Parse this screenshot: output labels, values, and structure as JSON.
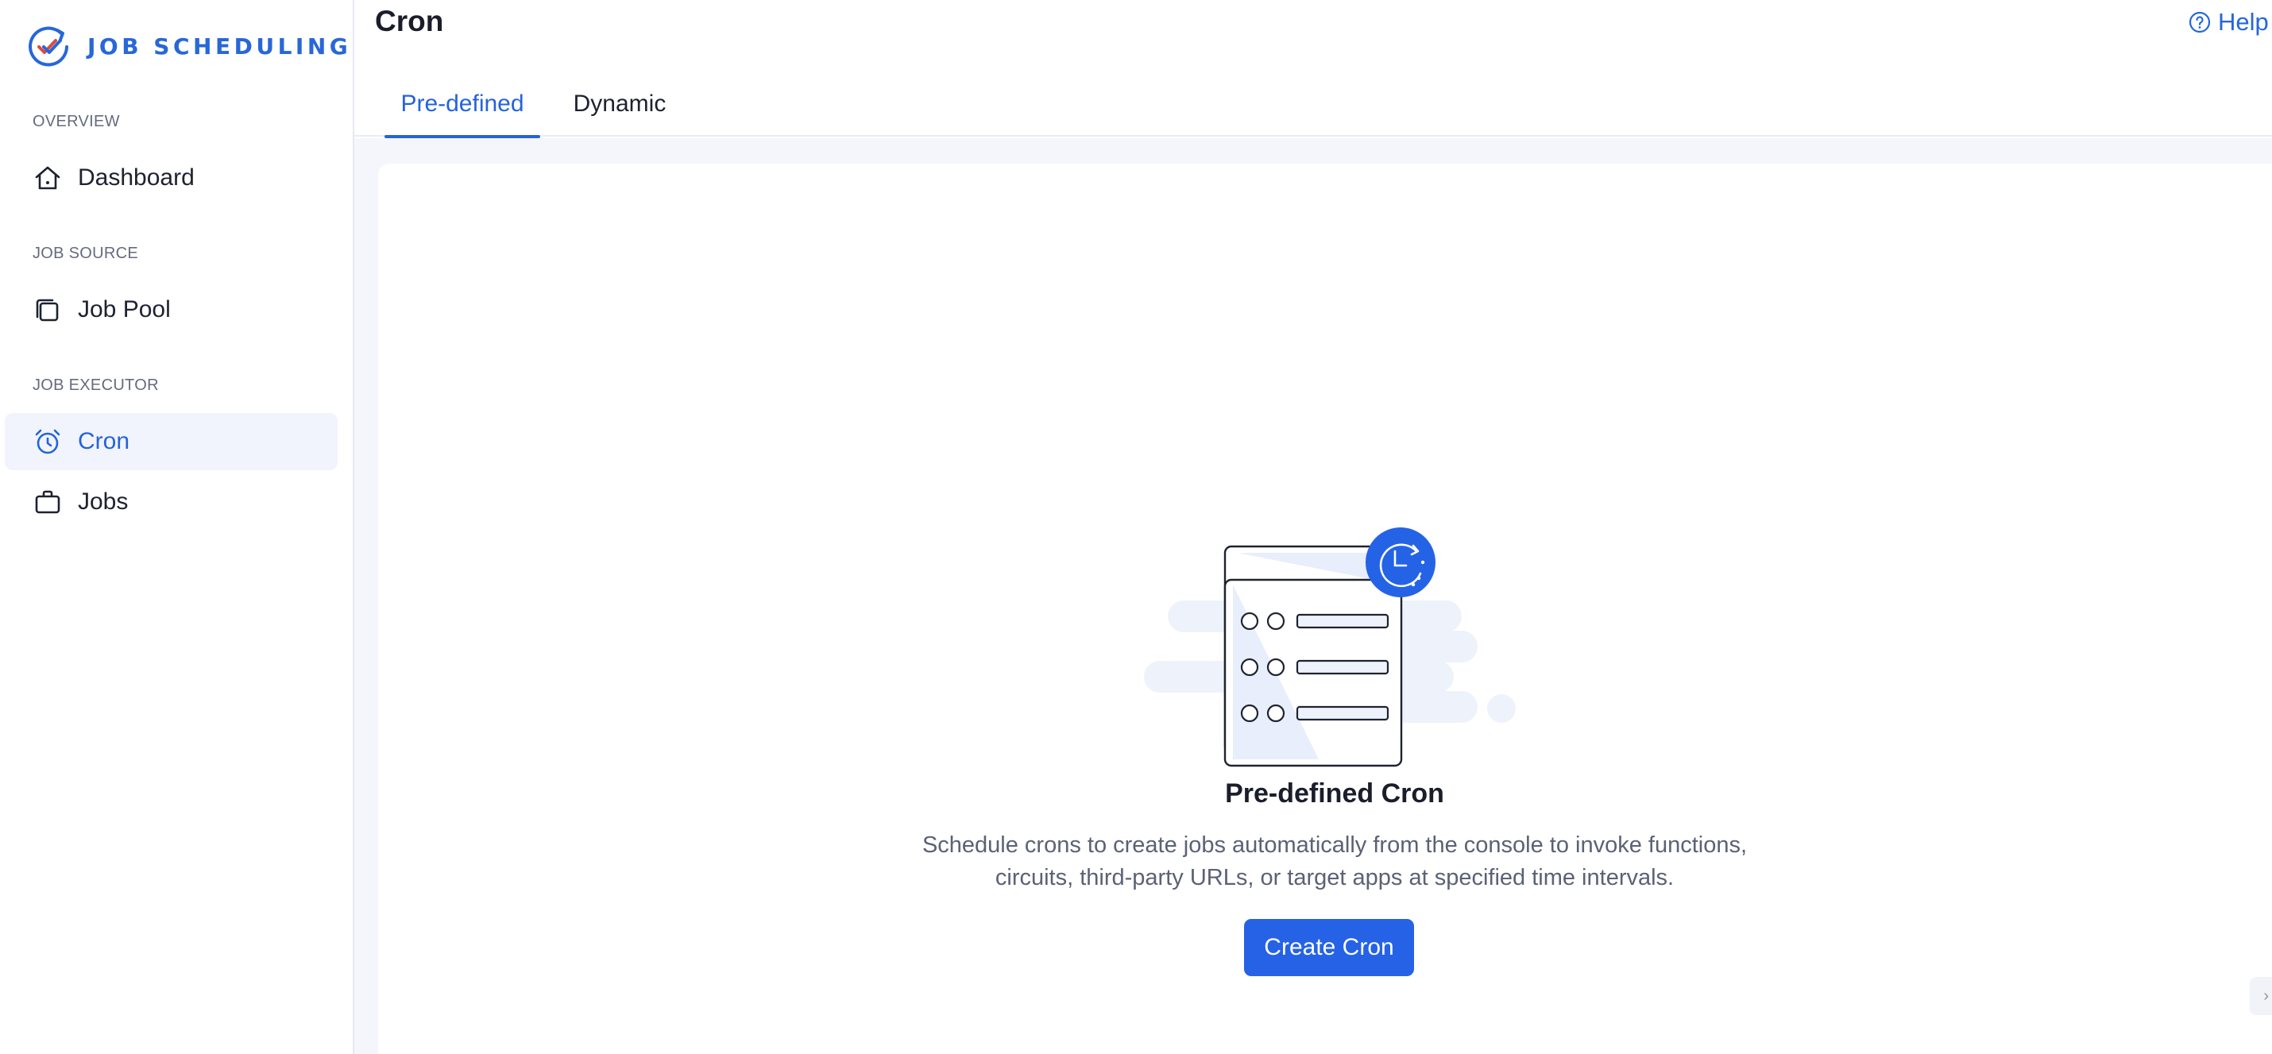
{
  "sidebar": {
    "brand": "JOB SCHEDULING",
    "sections": [
      {
        "label": "OVERVIEW"
      },
      {
        "label": "JOB SOURCE"
      },
      {
        "label": "JOB EXECUTOR"
      }
    ],
    "items": [
      {
        "label": "Dashboard",
        "icon": "home-icon"
      },
      {
        "label": "Job Pool",
        "icon": "stack-icon"
      },
      {
        "label": "Cron",
        "icon": "alarm-clock-icon",
        "active": true
      },
      {
        "label": "Jobs",
        "icon": "briefcase-icon"
      }
    ]
  },
  "header": {
    "title": "Cron",
    "help": "Help"
  },
  "tabs": [
    {
      "label": "Pre-defined",
      "active": true
    },
    {
      "label": "Dynamic",
      "active": false
    }
  ],
  "empty_state": {
    "title": "Pre-defined Cron",
    "description_line1": "Schedule crons to create jobs automatically from the console to invoke functions,",
    "description_line2": "circuits, third-party URLs, or target apps at specified time intervals.",
    "button": "Create Cron",
    "illustration": "cron-list-illustration"
  },
  "colors": {
    "accent": "#2563d9",
    "button": "#2562e6",
    "active_bg": "#f1f4fc",
    "content_bg": "#f4f6fb"
  }
}
